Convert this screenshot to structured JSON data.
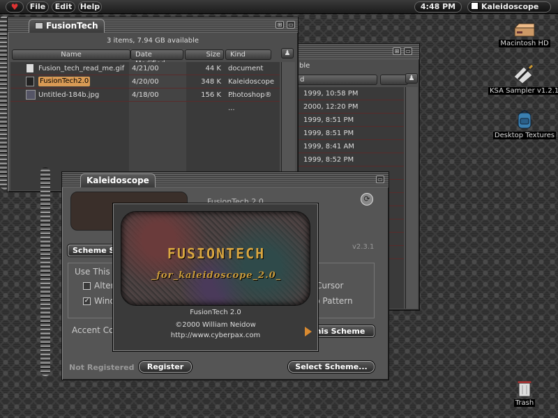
{
  "menubar": {
    "apple_symbol": "♥",
    "menus": [
      "File",
      "Edit",
      "Help"
    ],
    "clock": "4:48 PM",
    "app": "Kaleidoscope"
  },
  "desktop": {
    "icons": [
      {
        "label": "Macintosh HD",
        "icon": "hard-disk-icon"
      },
      {
        "label": "KSA Sampler v1.2.1",
        "icon": "pen-sampler-icon"
      },
      {
        "label": "Desktop Textures",
        "icon": "backpack-folder-icon"
      },
      {
        "label": "Trash",
        "icon": "trash-can-icon"
      }
    ]
  },
  "finder": {
    "title": "FusionTech",
    "status": "3 items, 7.94 GB available",
    "columns": {
      "name": "Name",
      "date": "Date Modified",
      "size": "Size",
      "kind": "Kind"
    },
    "rows": [
      {
        "name": "Fusion_tech_read_me.gif",
        "date": "4/21/00",
        "size": "44 K",
        "kind": "document"
      },
      {
        "name": "FusionTech2.0",
        "date": "4/20/00",
        "size": "348 K",
        "kind": "Kaleidoscope ..."
      },
      {
        "name": "Untitled-184b.jpg",
        "date": "4/18/00",
        "size": "156 K",
        "kind": "Photoshop® ..."
      }
    ]
  },
  "back_window": {
    "status_fragment": "ble",
    "header_fragment": "d",
    "dates": [
      "1999, 10:58 PM",
      "2000, 12:20 PM",
      "1999, 8:51 PM",
      "1999, 8:51 PM",
      "1999, 8:41 AM",
      "1999, 8:52 PM"
    ]
  },
  "kaleidoscope": {
    "title": "Kaleidoscope",
    "scheme_name": "FusionTech 2.0",
    "version": "v2.3.1",
    "preview_caption": "for kaleidoscope 2.0",
    "tab_fragment": "Scheme S",
    "use_this_fragment": "Use This",
    "options": [
      {
        "label": "Alter",
        "checked": false
      },
      {
        "label": "Wind",
        "checked": true
      }
    ],
    "right_options": [
      "Cursor",
      "p Pattern"
    ],
    "accent_fragment": "Accent Co",
    "this_scheme_fragment": "his Scheme",
    "not_registered": "Not Registered",
    "register_btn": "Register",
    "select_btn": "Select Scheme..."
  },
  "about": {
    "logo_title": "FUSIONTECH",
    "logo_sub": "_for_kaleidoscope_2.0_",
    "name": "FusionTech 2.0",
    "copyright": "©2000 William Neidow",
    "url": "http://www.cyberpax.com"
  }
}
